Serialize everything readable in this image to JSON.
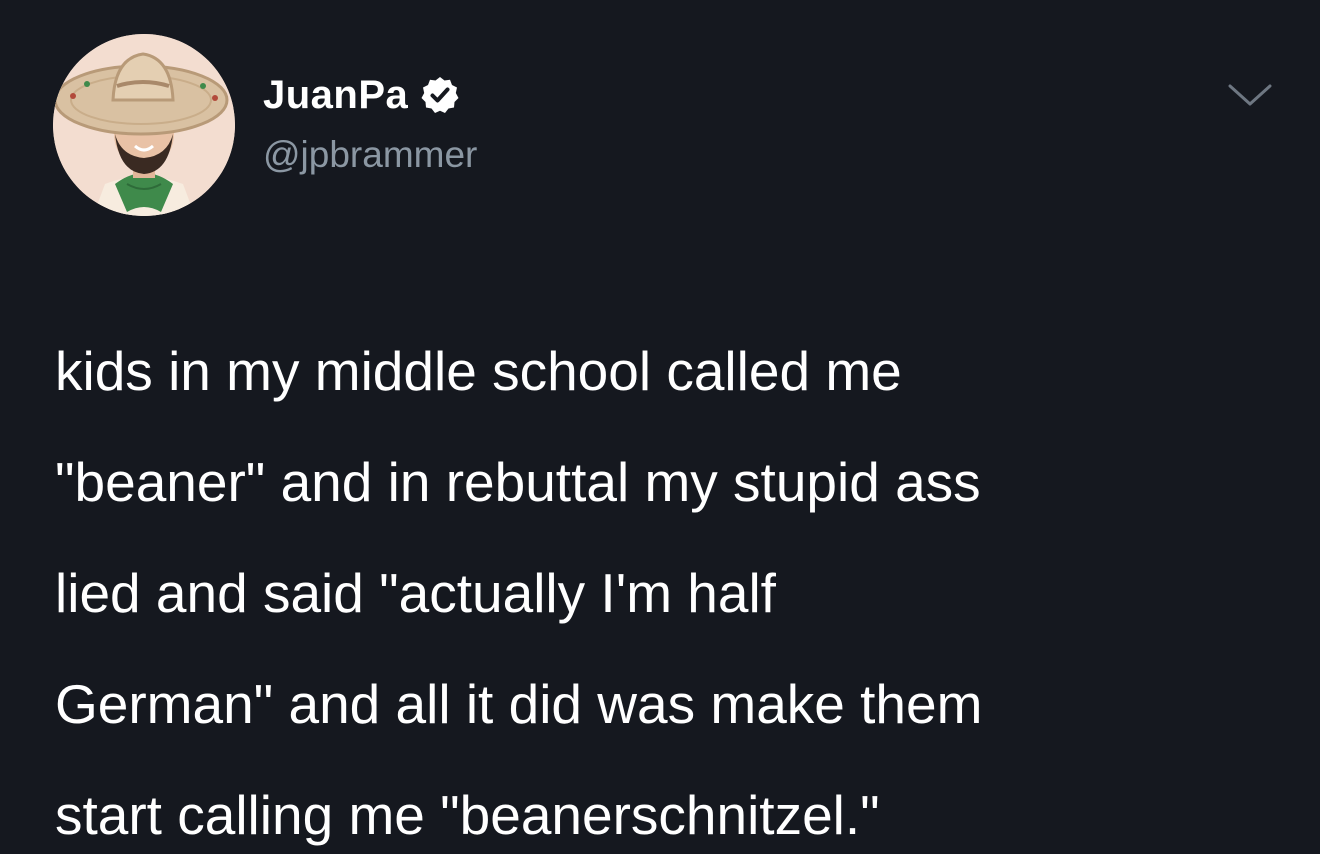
{
  "author": {
    "display_name": "JuanPa",
    "handle": "@jpbrammer",
    "verified": true,
    "avatar_icon": "avatar-sombrero-illustration"
  },
  "menu": {
    "icon": "chevron-down-icon"
  },
  "tweet": {
    "lines": [
      "kids in my middle school called me",
      "\"beaner\" and in rebuttal my stupid ass",
      "lied and said \"actually I'm half",
      "German\" and all it did was make them",
      "start calling me \"beanerschnitzel.\""
    ]
  },
  "colors": {
    "background": "#15181f",
    "text": "#ffffff",
    "handle": "#8b97a3"
  }
}
